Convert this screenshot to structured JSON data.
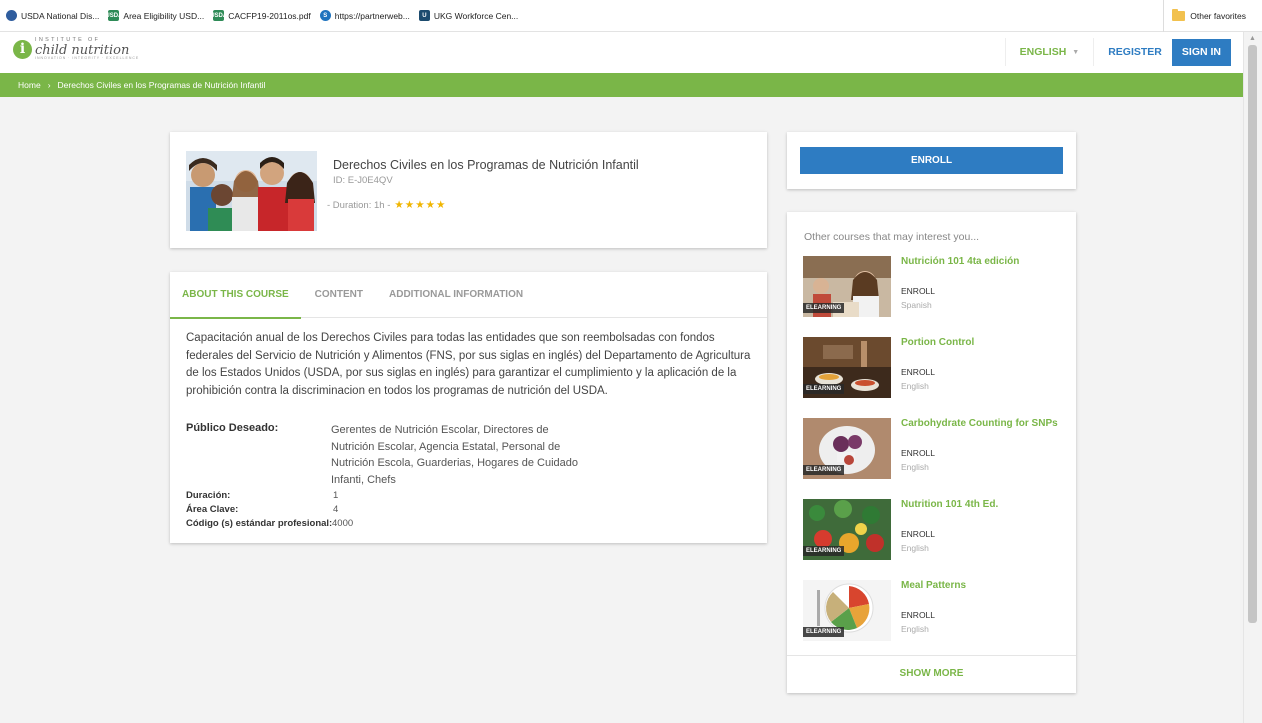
{
  "bookmarks": [
    {
      "label": "USDA National Dis...",
      "icon": "shield-icon",
      "color": "#2f5d9e",
      "glyph": ""
    },
    {
      "label": "Area Eligibility USD...",
      "icon": "usda-icon",
      "color": "#2e8b57",
      "glyph": "USDA"
    },
    {
      "label": "CACFP19-2011os.pdf",
      "icon": "usda-icon",
      "color": "#2e8b57",
      "glyph": "USDA"
    },
    {
      "label": "https://partnerweb...",
      "icon": "sharepoint-icon",
      "color": "#1e73be",
      "glyph": "S"
    },
    {
      "label": "UKG Workforce Cen...",
      "icon": "ukg-icon",
      "color": "#1c4b6e",
      "glyph": "U"
    }
  ],
  "other_favorites": "Other favorites",
  "header": {
    "logo_top": "INSTITUTE OF",
    "logo_main": "child nutrition",
    "logo_sub": "INNOVATION · INTEGRITY · EXCELLENCE",
    "language": "ENGLISH",
    "register": "REGISTER",
    "sign_in": "SIGN IN"
  },
  "breadcrumb": {
    "home": "Home",
    "separator": "›",
    "current": "Derechos Civiles en los Programas de Nutrición Infantil"
  },
  "course": {
    "title": "Derechos Civiles en los Programas de Nutrición Infantil",
    "id": "ID: E-J0E4QV",
    "duration": "- Duration: 1h -",
    "stars": "★★★★★",
    "rating": 5
  },
  "tabs": [
    "ABOUT THIS COURSE",
    "CONTENT",
    "ADDITIONAL INFORMATION"
  ],
  "about": {
    "description": "Capacitación anual de los Derechos Civiles para todas las entidades que son reembolsadas con fondos federales del Servicio de Nutrición y Alimentos (FNS, por sus siglas en inglés) del Departamento de Agricultura de los Estados Unidos (USDA, por sus siglas en inglés) para garantizar el cumplimiento y la aplicación de la prohibición contra la discriminacion en todos los programas de nutrición del USDA.",
    "publico_label": "Público Deseado:",
    "publico_value": "Gerentes de Nutrición Escolar, Directores de Nutrición Escolar, Agencia Estatal, Personal de Nutrición Escola, Guarderias, Hogares de Cuidado Infanti, Chefs",
    "duracion_label": "Duración:",
    "duracion_value": "1",
    "area_label": "Área Clave:",
    "area_value": "4",
    "codigo_label": "Código (s) estándar profesional:",
    "codigo_value": "4000"
  },
  "enroll_label": "ENROLL",
  "other_courses": {
    "heading": "Other courses that may interest you...",
    "badge": "ELEARNING",
    "items": [
      {
        "title": "Nutrición 101 4ta edición",
        "enroll": "ENROLL",
        "language": "Spanish"
      },
      {
        "title": "Portion Control",
        "enroll": "ENROLL",
        "language": "English"
      },
      {
        "title": "Carbohydrate Counting for SNPs",
        "enroll": "ENROLL",
        "language": "English"
      },
      {
        "title": "Nutrition 101 4th Ed.",
        "enroll": "ENROLL",
        "language": "English"
      },
      {
        "title": "Meal Patterns",
        "enroll": "ENROLL",
        "language": "English"
      }
    ],
    "show_more": "SHOW MORE"
  },
  "colors": {
    "brand_green": "#7ab648",
    "brand_blue": "#2e7cc2",
    "star": "#f0b500"
  }
}
